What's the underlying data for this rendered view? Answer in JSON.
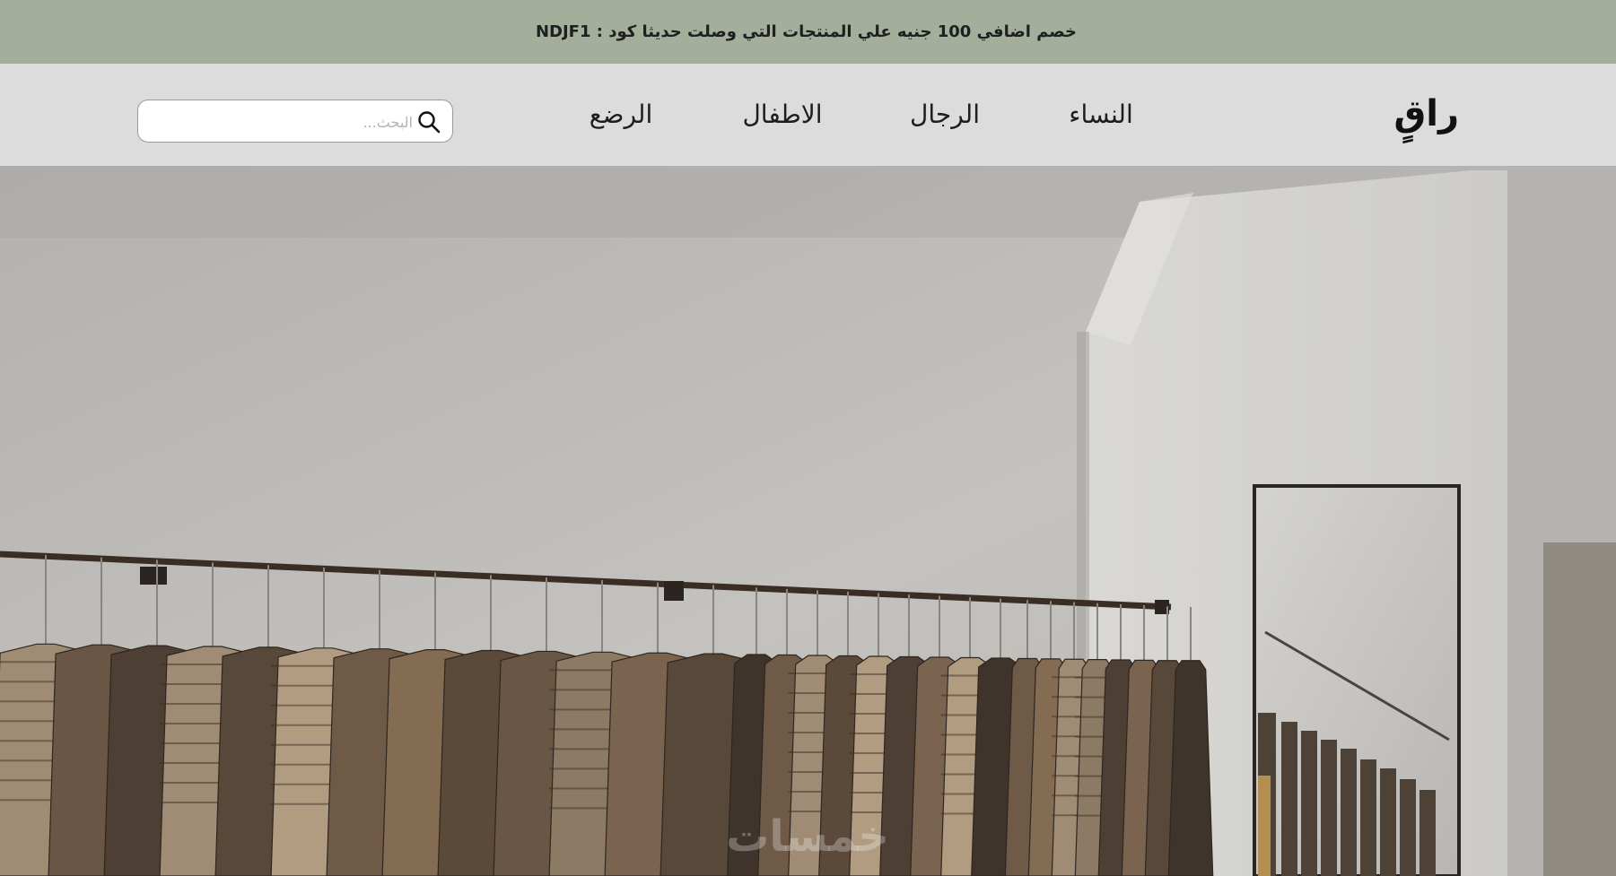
{
  "promo": {
    "text": "خصم اضافي 100 جنيه علي المنتجات التي وصلت حديثا كود : NDJF1"
  },
  "header": {
    "logo": "راقٍ",
    "nav": [
      {
        "label": "النساء"
      },
      {
        "label": "الرجال"
      },
      {
        "label": "الاطفال"
      },
      {
        "label": "الرضع"
      }
    ],
    "search": {
      "placeholder": "البحث...",
      "value": "",
      "icon": "search-icon"
    }
  },
  "hero": {
    "image": "clothing-rack-store-photo",
    "watermark": "خمسات"
  },
  "colors": {
    "promo_bg": "#a3ae9b",
    "header_bg": "#dcdcdc",
    "text": "#1d1d1d"
  }
}
